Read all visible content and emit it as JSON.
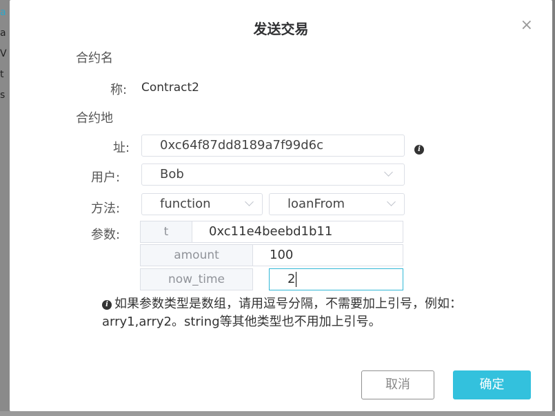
{
  "background": {
    "fragments": [
      "a",
      "a",
      "V",
      "t",
      "s"
    ]
  },
  "dialog": {
    "title": "发送交易",
    "close_glyph": "×",
    "contract_name_label_line1": "合约名",
    "contract_name_label_line2": "称:",
    "contract_name_value": "Contract2",
    "contract_address_label_line1": "合约地",
    "contract_address_label_line2": "址:",
    "contract_address_value": "0xc64f87dd8189a7f99d6c",
    "user_label": "用户:",
    "user_value": "Bob",
    "method_label": "方法:",
    "method_type_value": "function",
    "method_name_value": "loanFrom",
    "params_label": "参数:",
    "params": [
      {
        "name": "t",
        "value": "0xc11e4beebd1b11"
      },
      {
        "name": "amount",
        "value": "100"
      },
      {
        "name": "now_time",
        "value": "2"
      }
    ],
    "info_icon_glyph": "i",
    "note": "如果参数类型是数组，请用逗号分隔，不需要加上引号，例如：arry1,arry2。string等其他类型也不用加上引号。",
    "cancel_label": "取消",
    "confirm_label": "确定"
  },
  "colors": {
    "accent": "#33c1dd",
    "overlay": "#7f7f7f"
  }
}
